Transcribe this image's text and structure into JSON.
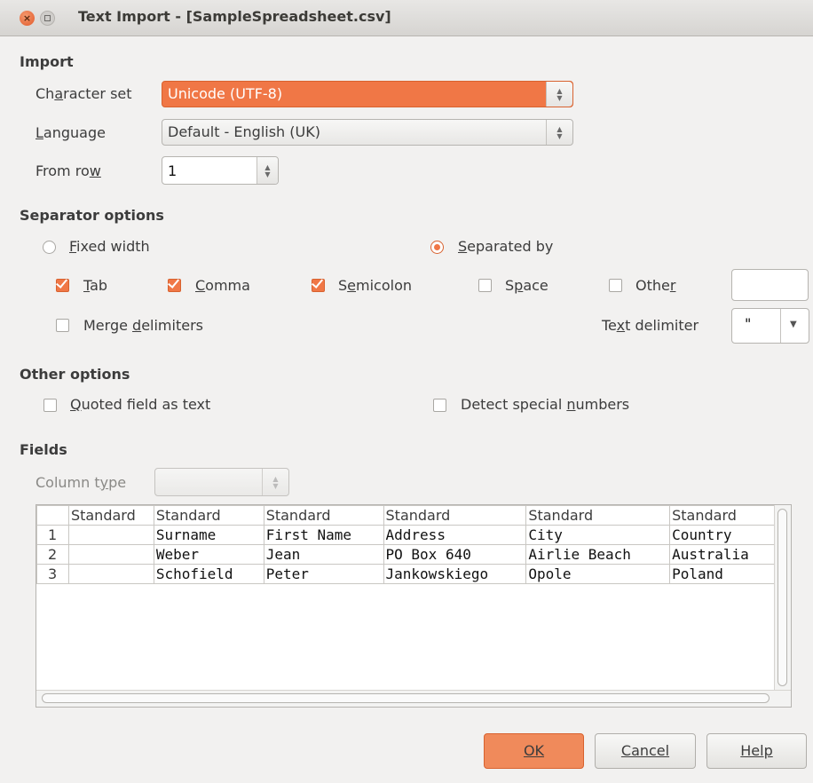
{
  "window": {
    "title": "Text Import - [SampleSpreadsheet.csv]"
  },
  "import": {
    "section": "Import",
    "charset_label": "Character set",
    "charset_value": "Unicode (UTF-8)",
    "language_label": "Language",
    "language_value": "Default - English (UK)",
    "fromrow_label": "From row",
    "fromrow_value": "1"
  },
  "separator": {
    "section": "Separator options",
    "fixed_width": "Fixed width",
    "separated_by": "Separated by",
    "tab": "Tab",
    "comma": "Comma",
    "semicolon": "Semicolon",
    "space": "Space",
    "other": "Other",
    "other_value": "",
    "merge": "Merge delimiters",
    "text_delim_label": "Text delimiter",
    "text_delim_value": "\""
  },
  "other_options": {
    "section": "Other options",
    "quoted": "Quoted field as text",
    "detect": "Detect special numbers"
  },
  "fields": {
    "section": "Fields",
    "column_type_label": "Column type",
    "headers": [
      "Standard",
      "Standard",
      "Standard",
      "Standard",
      "Standard",
      "Standard"
    ],
    "rows": [
      {
        "n": "1",
        "cells": [
          "",
          "Surname",
          "First Name",
          "Address",
          "City",
          "Country"
        ]
      },
      {
        "n": "2",
        "cells": [
          "",
          "Weber",
          "Jean",
          "PO Box 640",
          "Airlie Beach",
          "Australia"
        ]
      },
      {
        "n": "3",
        "cells": [
          "",
          "Schofield",
          "Peter",
          "Jankowskiego",
          "Opole",
          "Poland"
        ]
      }
    ]
  },
  "buttons": {
    "ok": "OK",
    "cancel": "Cancel",
    "help": "Help"
  }
}
